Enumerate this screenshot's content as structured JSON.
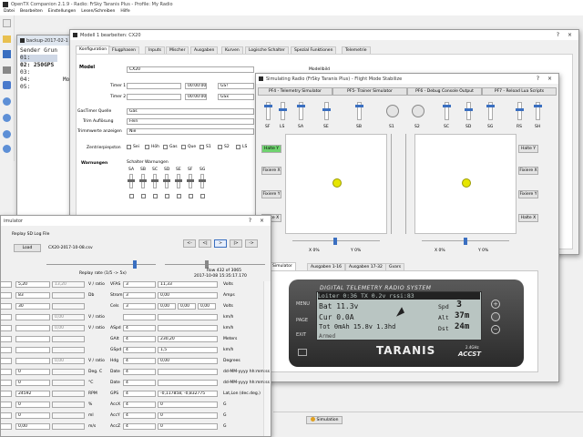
{
  "main": {
    "title": "OpenTX Companion 2.1.9 - Radio: FrSky Taranis Plus - Profile: My Radio",
    "menu": [
      "Datei",
      "Bearbeiten",
      "Einstellungen",
      "Lesen/Schreiben",
      "Hilfe"
    ]
  },
  "backup": {
    "title": "backup-2017-02-1",
    "lines": [
      "Sender Grun",
      "01:",
      "02: 250GPS",
      "03:",
      "04:",
      "05:"
    ],
    "trail": [
      "Mo",
      ""
    ]
  },
  "model": {
    "title": "Modell 1 bearbeiten: CX20",
    "tabs": [
      "Konfiguration",
      "Flugphasen",
      "Inputs",
      "Mischer",
      "Ausgaben",
      "Kurven",
      "Logische Schalter",
      "Spezial Funktionen",
      "Telemetrie"
    ],
    "section": "Model",
    "name": "CX20",
    "name_label": "Name",
    "modelbild": "Modellbild",
    "quad": "Quad",
    "timer1": "Timer 1",
    "timer2": "Timer 2",
    "time1": "00:00:00",
    "time2": "00:00:00",
    "mode1": "GS!",
    "mode2": "GSx",
    "gas_quelle_label": "GasTimer Quelle",
    "gas_quelle": "Gas",
    "trim_label": "Trim Auflösung",
    "trim": "Fein",
    "trimm_label": "Trimmwerte anzeigen",
    "trimm": "Nie",
    "zentr_label": "Zentrierpiepston",
    "zentr_items": [
      "Sei",
      "Höh",
      "Gas",
      "Que",
      "S1",
      "S2",
      "LS"
    ],
    "warn_label": "Warnungen",
    "warn_title": "Schalter Warnungen",
    "warn_sw": [
      "SA",
      "SB",
      "SC",
      "SD",
      "SE",
      "SF",
      "SG"
    ]
  },
  "sim": {
    "title": "Simulating Radio (FrSky Taranis Plus) - Flight Mode Stabilize",
    "tabs": [
      "PF4 - Telemetry Simulator",
      "PF5- Trainer Simulator",
      "PF6 - Debug Console Output",
      "PF7 - Reload Lua Scripts"
    ],
    "sw_left": [
      "SF",
      "LS",
      "SA",
      "SE",
      "SB"
    ],
    "sw_right": [
      "S1",
      "S2",
      "SC",
      "SD",
      "SG",
      "RS",
      "SH"
    ],
    "side_btns": [
      "Halte Y",
      "Fixiere X",
      "Fixiere Y",
      "Halte X"
    ],
    "side_btns_r": [
      "Halte Y",
      "Fixiere X",
      "Fixiere Y",
      "Halte X"
    ],
    "xlab": "X 0%",
    "ylab": "Y 0%",
    "xlab2": "X 0%",
    "ylab2": "Y 0%",
    "bottom_tabs": [
      "Simulator",
      "Ausgaben 1-16",
      "Ausgaben 17-32",
      "Gvars"
    ],
    "sim_button": "Simulation"
  },
  "lcd": {
    "header": "DIGITAL TELEMETRY RADIO SYSTEM",
    "l1": "Loiter 0:36 TX 0.2v rssi:83",
    "bat": "Bat 11.3v",
    "spd": "Spd",
    "spd_v": "3",
    "spd_u": "km h",
    "cur": "Cur 0.0A",
    "alt": "Alt",
    "alt_v": "37m",
    "tot": "Tot  0mAh 15.8v 1.3hd",
    "dst": "Dst",
    "dst_v": "24m",
    "armed": "Armed",
    "brand": "TARANIS",
    "accst": "ACCST",
    "ghz": "2.4GHz",
    "menu": "MENU",
    "page": "PAGE",
    "exit": "EXIT"
  },
  "tel": {
    "title": "imulator",
    "replay_label": "Replay SD Log File",
    "load": "Load",
    "file": "CX20-2017-10-08.csv",
    "replay_rate": "Replay rate (1/5 -> 5x)",
    "row_info": "Row 432 of 3065",
    "date": "2017-10-08 15:35:17.170",
    "nav": [
      "<-",
      "<|",
      ">",
      "|>",
      "->"
    ],
    "left_rows": [
      [
        "5,20",
        "13,20",
        "V / ratio",
        "VFAS"
      ],
      [
        "83",
        "",
        "Db",
        "Strom"
      ],
      [
        "30",
        "",
        "",
        "Cels"
      ],
      [
        "",
        "0,00",
        "V / ratio",
        ""
      ],
      [
        "",
        "0,00",
        "V / ratio",
        "ASpd"
      ],
      [
        "",
        "",
        "",
        "GAlt"
      ],
      [
        "",
        "",
        "",
        "GSpd"
      ],
      [
        "",
        "0,00",
        "V / ratio",
        "Hdg"
      ],
      [
        "0",
        "",
        "Deg. C",
        "Date"
      ],
      [
        "0",
        "",
        "°C",
        "Date"
      ],
      [
        "24592",
        "",
        "RPM",
        "GPS"
      ],
      [
        "0",
        "",
        "%",
        "AccX"
      ],
      [
        "0",
        "",
        "ml",
        "AccY"
      ],
      [
        "0,00",
        "",
        "m/s",
        "AccZ"
      ]
    ],
    "right_rows": [
      [
        "3",
        "11,33",
        "Volts"
      ],
      [
        "3",
        "0,00",
        "Amps"
      ],
      [
        "3",
        "0,00",
        "Volts"
      ],
      [
        "",
        "",
        "km/h"
      ],
      [
        "4",
        "",
        "km/h"
      ],
      [
        "4",
        "230,20",
        "Meters"
      ],
      [
        "4",
        "1,5",
        "km/h"
      ],
      [
        "4",
        "0,00",
        "Degrees"
      ],
      [
        "4",
        "",
        "dd-MM-yyyy hh:mm:ss"
      ],
      [
        "4",
        "",
        "dd-MM-yyyy hh:mm:ss"
      ],
      [
        "4",
        "-0,117858, -0,832775",
        "Lat,Lon (dec.deg.)"
      ],
      [
        "4",
        "0",
        "G"
      ],
      [
        "4",
        "0",
        "G"
      ],
      [
        "4",
        "0",
        "G"
      ]
    ],
    "cels_vals": [
      "0,00",
      "0,00",
      "0,00"
    ]
  }
}
